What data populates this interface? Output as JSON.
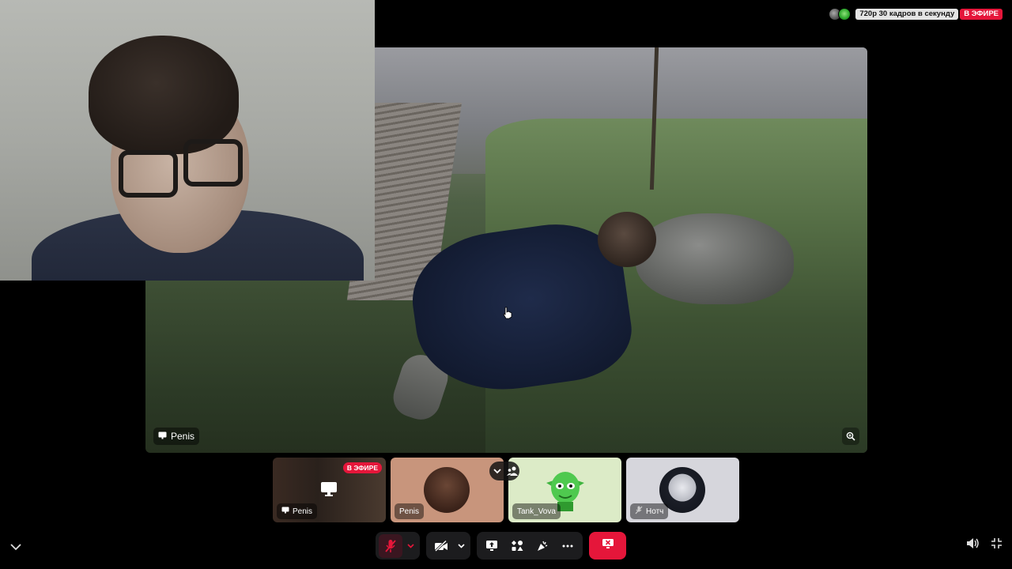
{
  "status_bar": {
    "quality": "720p 30 кадров в секунду",
    "live": "В ЭФИРЕ"
  },
  "main_stage": {
    "label": "Penis",
    "icon": "screen-share-icon"
  },
  "participants": [
    {
      "name": "Penis",
      "icon": "screen-share-icon",
      "live": "В ЭФИРЕ"
    },
    {
      "name": "Penis"
    },
    {
      "name": "Tank_Vova"
    },
    {
      "name": "Нотч",
      "icon": "mic-off-icon"
    }
  ],
  "controls": {
    "mic": "mic-off-icon",
    "camera": "camera-off-icon",
    "screen_share": "screen-share-icon",
    "activities": "activities-icon",
    "soundboard": "soundboard-icon",
    "more": "more-icon",
    "end_call": "end-call-icon"
  },
  "colors": {
    "live_red": "#e5163a",
    "bar_bg": "#1c1c1e"
  }
}
